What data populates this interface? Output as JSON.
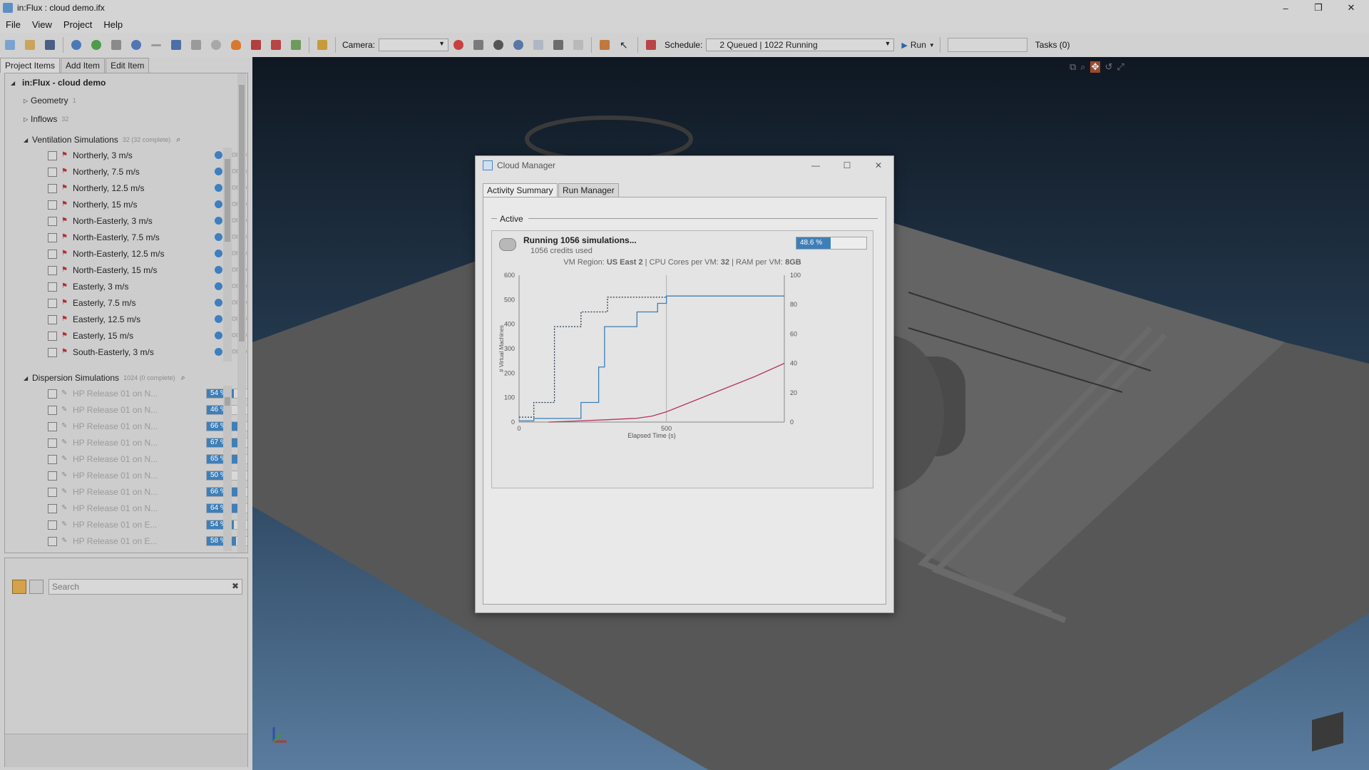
{
  "window": {
    "title": "in:Flux : cloud demo.ifx",
    "minimize": "–",
    "maximize": "❐",
    "close": "✕"
  },
  "menu": [
    "File",
    "View",
    "Project",
    "Help"
  ],
  "toolbar": {
    "camera_label": "Camera:",
    "camera_value": "",
    "schedule_label": "Schedule:",
    "schedule_value": "2 Queued | 1022 Running",
    "run_label": "Run",
    "tasks_label": "Tasks (0)"
  },
  "left_tabs": [
    "Project Items",
    "Add Item",
    "Edit Item"
  ],
  "tree": {
    "root": "in:Flux - cloud demo",
    "geometry": {
      "label": "Geometry",
      "count": "1"
    },
    "inflows": {
      "label": "Inflows",
      "count": "32"
    },
    "ventilation": {
      "label": "Ventilation Simulations",
      "count": "32 (32 complete)"
    },
    "ventilation_items": [
      {
        "name": "Northerly, 3 m/s",
        "status": "Complete"
      },
      {
        "name": "Northerly, 7.5 m/s",
        "status": "Complete"
      },
      {
        "name": "Northerly, 12.5 m/s",
        "status": "Complete"
      },
      {
        "name": "Northerly, 15 m/s",
        "status": "Complete"
      },
      {
        "name": "North-Easterly, 3 m/s",
        "status": "Complete"
      },
      {
        "name": "North-Easterly, 7.5 m/s",
        "status": "Complete"
      },
      {
        "name": "North-Easterly, 12.5 m/s",
        "status": "Complete"
      },
      {
        "name": "North-Easterly, 15 m/s",
        "status": "Complete"
      },
      {
        "name": "Easterly, 3 m/s",
        "status": "Complete"
      },
      {
        "name": "Easterly, 7.5 m/s",
        "status": "Complete"
      },
      {
        "name": "Easterly, 12.5 m/s",
        "status": "Complete"
      },
      {
        "name": "Easterly, 15 m/s",
        "status": "Complete"
      },
      {
        "name": "South-Easterly, 3 m/s",
        "status": "Complete"
      }
    ],
    "dispersion": {
      "label": "Dispersion Simulations",
      "count": "1024 (0 complete)"
    },
    "dispersion_items": [
      {
        "name": "HP Release 01 on N...",
        "progress": 54,
        "label": "54 %"
      },
      {
        "name": "HP Release 01 on N...",
        "progress": 46,
        "label": "46 %"
      },
      {
        "name": "HP Release 01 on N...",
        "progress": 66,
        "label": "66 %"
      },
      {
        "name": "HP Release 01 on N...",
        "progress": 67,
        "label": "67 %"
      },
      {
        "name": "HP Release 01 on N...",
        "progress": 65,
        "label": "65 %"
      },
      {
        "name": "HP Release 01 on N...",
        "progress": 50,
        "label": "50 %"
      },
      {
        "name": "HP Release 01 on N...",
        "progress": 66,
        "label": "66 %"
      },
      {
        "name": "HP Release 01 on N...",
        "progress": 64,
        "label": "64 %"
      },
      {
        "name": "HP Release 01 on E...",
        "progress": 54,
        "label": "54 %"
      },
      {
        "name": "HP Release 01 on E...",
        "progress": 58,
        "label": "58 %"
      }
    ]
  },
  "search": {
    "placeholder": "Search"
  },
  "dialog": {
    "title": "Cloud Manager",
    "tabs": [
      "Activity Summary",
      "Run Manager"
    ],
    "group_label": "Active",
    "status_title": "Running 1056 simulations...",
    "credits": "1056 credits used",
    "progress": 48.6,
    "progress_label": "48.6 %",
    "vm_info": {
      "region_label": "VM Region: ",
      "region": "US East 2",
      "cores_label": " | CPU Cores per VM: ",
      "cores": "32",
      "ram_label": " | RAM per VM: ",
      "ram": "8GB"
    }
  },
  "chart_data": {
    "type": "line",
    "xlabel": "Elapsed Time (s)",
    "ylabel": "# Virtual Machines",
    "xlim": [
      0,
      900
    ],
    "ylim": [
      0,
      600
    ],
    "y2lim": [
      0,
      100
    ],
    "xticks": [
      0,
      500
    ],
    "yticks": [
      0,
      100,
      200,
      300,
      400,
      500,
      600
    ],
    "y2ticks": [
      0,
      20,
      40,
      60,
      80,
      100
    ],
    "grid": "x=500 vertical line",
    "series": [
      {
        "style": "dashed",
        "color": "#2a3a50",
        "axis": "left",
        "x": [
          0,
          50,
          50,
          120,
          120,
          210,
          210,
          300,
          300,
          410,
          410,
          500
        ],
        "y": [
          20,
          20,
          80,
          80,
          390,
          390,
          450,
          450,
          510,
          510,
          510,
          510
        ]
      },
      {
        "style": "solid",
        "color": "#3c7fb6",
        "axis": "left",
        "x": [
          0,
          50,
          50,
          210,
          210,
          270,
          270,
          290,
          290,
          400,
          400,
          470,
          470,
          500,
          500,
          900
        ],
        "y": [
          5,
          5,
          15,
          15,
          80,
          80,
          225,
          225,
          390,
          390,
          450,
          450,
          485,
          485,
          515,
          515
        ]
      },
      {
        "style": "solid",
        "color": "#b5355f",
        "axis": "right",
        "x": [
          100,
          200,
          300,
          400,
          450,
          500,
          600,
          700,
          800,
          900
        ],
        "y": [
          0,
          0.8,
          1.6,
          2.6,
          4,
          7,
          15,
          23,
          31,
          40
        ]
      }
    ]
  }
}
